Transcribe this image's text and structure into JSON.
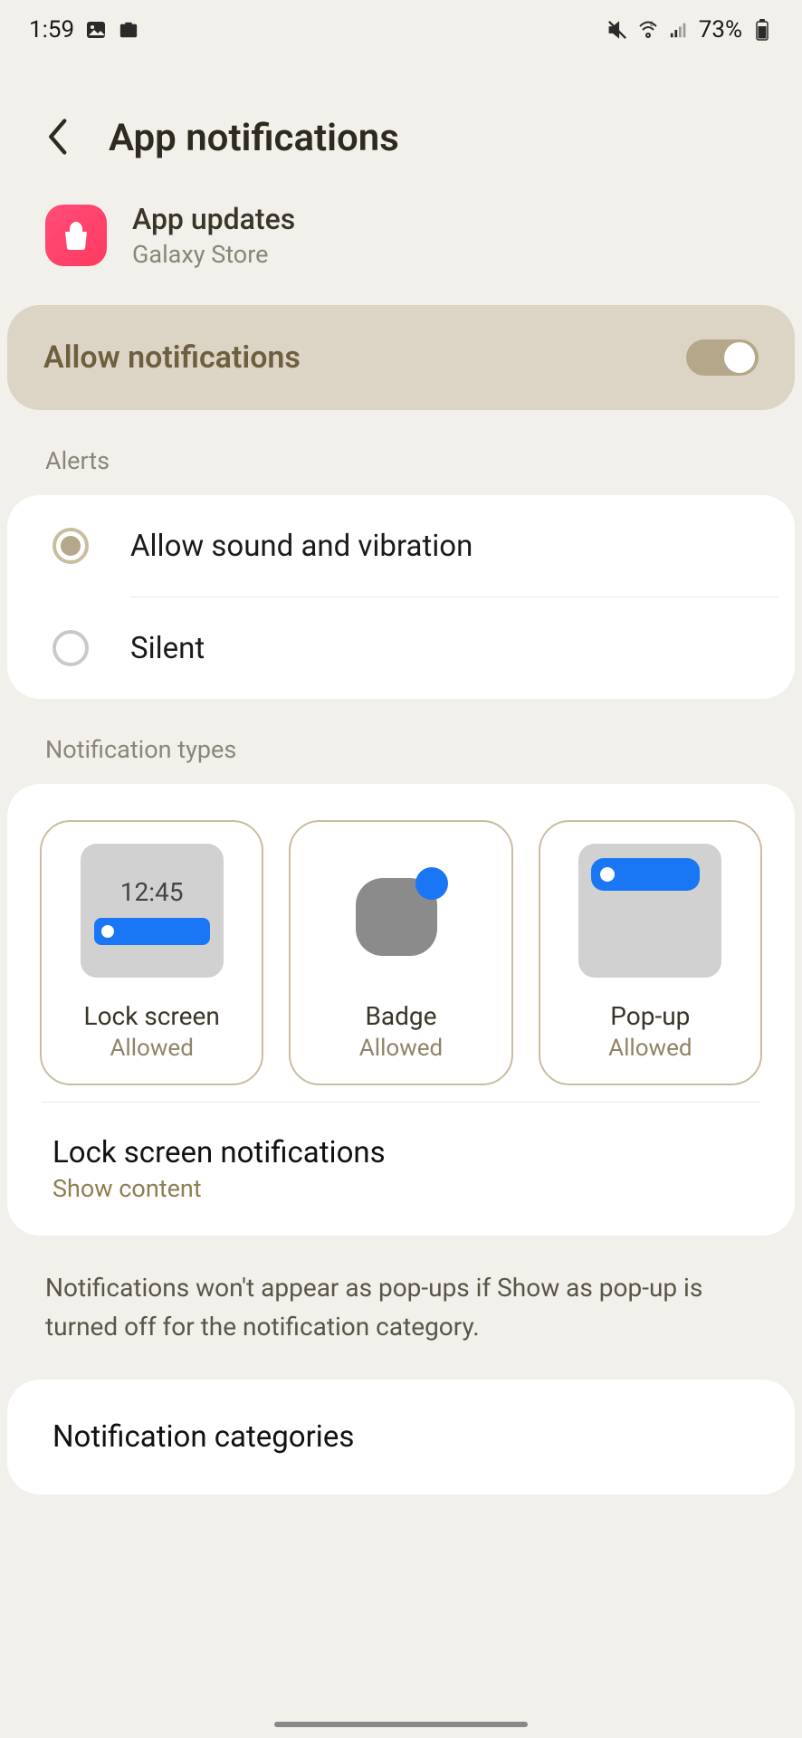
{
  "status": {
    "time": "1:59",
    "battery": "73%"
  },
  "header": {
    "title": "App notifications"
  },
  "app": {
    "name": "App updates",
    "source": "Galaxy Store"
  },
  "allow": {
    "label": "Allow notifications",
    "enabled": true
  },
  "sections": {
    "alerts_label": "Alerts",
    "types_label": "Notification types"
  },
  "alerts": {
    "options": [
      {
        "label": "Allow sound and vibration",
        "selected": true
      },
      {
        "label": "Silent",
        "selected": false
      }
    ]
  },
  "types": {
    "lockscreen": {
      "title": "Lock screen",
      "status": "Allowed",
      "preview_time": "12:45"
    },
    "badge": {
      "title": "Badge",
      "status": "Allowed"
    },
    "popup": {
      "title": "Pop-up",
      "status": "Allowed"
    }
  },
  "lockscreen_setting": {
    "title": "Lock screen notifications",
    "subtitle": "Show content"
  },
  "info": "Notifications won't appear as pop-ups if Show as pop-up is turned off for the notification category.",
  "categories": {
    "title": "Notification categories"
  }
}
